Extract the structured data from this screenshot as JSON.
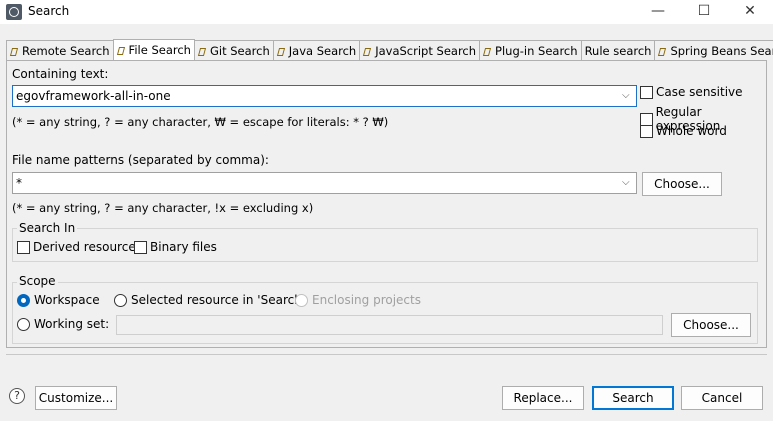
{
  "window": {
    "title": "Search",
    "minimize": "—",
    "maximize": "☐",
    "close": "✕"
  },
  "tabs": [
    {
      "label": "Remote Search",
      "active": false
    },
    {
      "label": "File Search",
      "active": true
    },
    {
      "label": "Git Search",
      "active": false
    },
    {
      "label": "Java Search",
      "active": false
    },
    {
      "label": "JavaScript Search",
      "active": false
    },
    {
      "label": "Plug-in Search",
      "active": false
    },
    {
      "label": "Rule search",
      "active": false
    },
    {
      "label": "Spring Beans Search",
      "active": false
    }
  ],
  "containing": {
    "label": "Containing text:",
    "value": "egovframework-all-in-one",
    "hint": "(* = any string, ? = any character, ₩ = escape for literals: * ? ₩)"
  },
  "options": {
    "case_sensitive": "Case sensitive",
    "regex": "Regular expression",
    "whole_word": "Whole word"
  },
  "patterns": {
    "label": "File name patterns (separated by comma):",
    "value": "*",
    "choose": "Choose...",
    "hint": "(* = any string, ? = any character, !x = excluding x)"
  },
  "search_in": {
    "label": "Search In",
    "derived": "Derived resources",
    "binary": "Binary files"
  },
  "scope": {
    "label": "Scope",
    "workspace": "Workspace",
    "selected": "Selected resource in 'Search'",
    "enclosing": "Enclosing projects",
    "working_set": "Working set:",
    "choose": "Choose..."
  },
  "footer": {
    "help": "?",
    "customize": "Customize...",
    "replace": "Replace...",
    "search": "Search",
    "cancel": "Cancel"
  }
}
